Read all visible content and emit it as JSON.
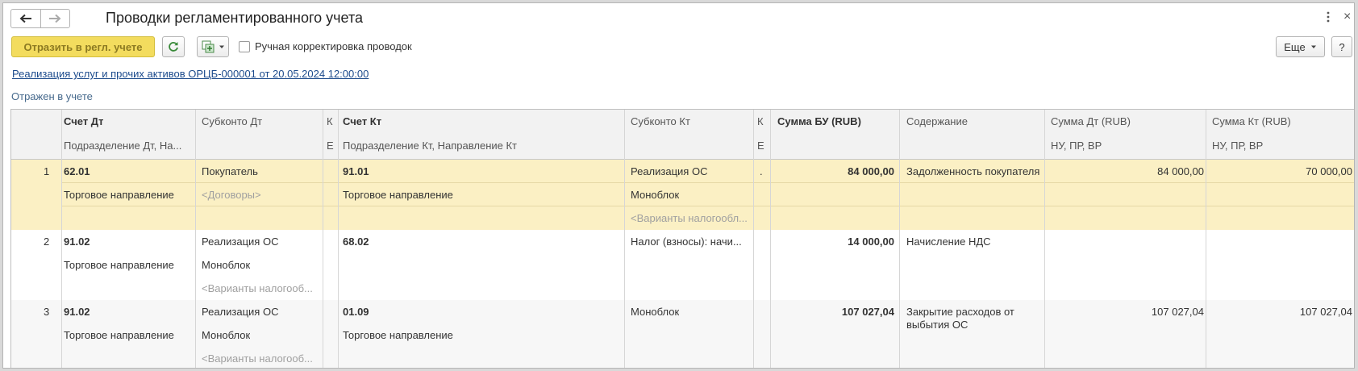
{
  "window": {
    "title": "Проводки регламентированного учета",
    "more_icon": "more-vert-icon",
    "close_label": "×"
  },
  "toolbar": {
    "post_label": "Отразить в регл. учете",
    "refresh_icon": "refresh-icon",
    "add_icon": "add-copy-icon",
    "manual_label": "Ручная корректировка проводок",
    "manual_checked": false,
    "more_label": "Еще",
    "help_label": "?"
  },
  "doc_link": "Реализация услуг и прочих активов ОРЦБ-000001 от 20.05.2024 12:00:00",
  "status": "Отражен в учете",
  "table": {
    "headers": {
      "acct_dt": "Счет Дт",
      "acct_dt_sub": "Подразделение Дт, На...",
      "subk_dt": "Субконто Дт",
      "k1": "К",
      "k1_sub": "Е",
      "acct_kt": "Счет Кт",
      "acct_kt_sub": "Подразделение Кт, Направление Кт",
      "subk_kt": "Субконто Кт",
      "k2": "К",
      "k2_sub": "Е",
      "sum_bu": "Сумма БУ (RUB)",
      "content": "Содержание",
      "sum_dt": "Сумма Дт (RUB)",
      "sum_dt_sub": "НУ, ПР, ВР",
      "sum_kt": "Сумма Кт (RUB)",
      "sum_kt_sub": "НУ, ПР, ВР"
    },
    "rows": [
      {
        "num": "1",
        "acct_dt": "62.01",
        "dept_dt": "Торговое направление",
        "subk_dt_1": "Покупатель",
        "subk_dt_2": "<Договоры>",
        "subk_dt_3": "",
        "acct_kt": "91.01",
        "dept_kt": "Торговое направление",
        "subk_kt_1": "Реализация ОС",
        "subk_kt_2": "Моноблок",
        "subk_kt_3": "<Варианты налогообл...",
        "k2": ".",
        "sum_bu": "84 000,00",
        "content": "Задолженность покупателя",
        "sum_dt": "84 000,00",
        "sum_kt": "70 000,00"
      },
      {
        "num": "2",
        "acct_dt": "91.02",
        "dept_dt": "Торговое направление",
        "subk_dt_1": "Реализация ОС",
        "subk_dt_2": "Моноблок",
        "subk_dt_3": "<Варианты налогооб...",
        "acct_kt": "68.02",
        "dept_kt": "",
        "subk_kt_1": "Налог (взносы): начи...",
        "subk_kt_2": "",
        "subk_kt_3": "",
        "k2": "",
        "sum_bu": "14 000,00",
        "content": "Начисление НДС",
        "sum_dt": "",
        "sum_kt": ""
      },
      {
        "num": "3",
        "acct_dt": "91.02",
        "dept_dt": "Торговое направление",
        "subk_dt_1": "Реализация ОС",
        "subk_dt_2": "Моноблок",
        "subk_dt_3": "<Варианты налогооб...",
        "acct_kt": "01.09",
        "dept_kt": "Торговое направление",
        "subk_kt_1": "Моноблок",
        "subk_kt_2": "",
        "subk_kt_3": "",
        "k2": "",
        "sum_bu": "107 027,04",
        "content": "Закрытие расходов от выбытия ОС",
        "sum_dt": "107 027,04",
        "sum_kt": "107 027,04"
      }
    ]
  }
}
